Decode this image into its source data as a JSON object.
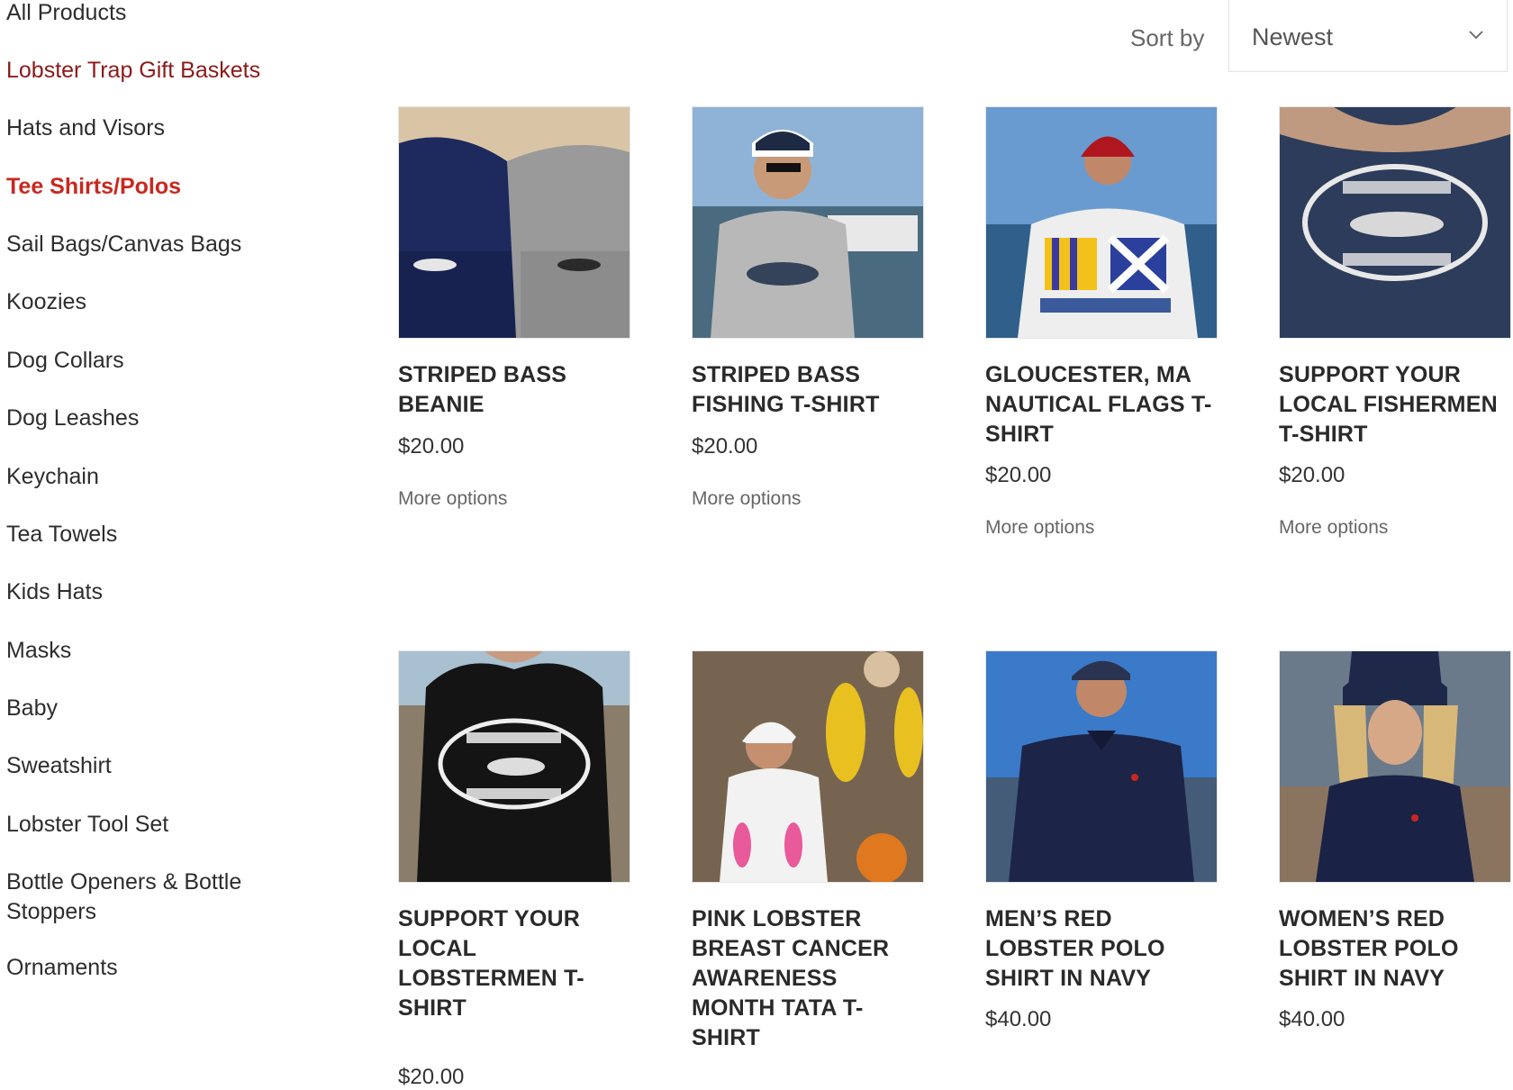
{
  "sidebar": {
    "categories": [
      "All Products",
      "Lobster Trap Gift Baskets",
      "Hats and Visors",
      "Tee Shirts/Polos",
      "Sail Bags/Canvas Bags",
      "Koozies",
      "Dog Collars",
      "Dog Leashes",
      "Keychain",
      "Tea Towels",
      "Kids Hats",
      "Masks",
      "Baby",
      "Sweatshirt",
      "Lobster Tool Set",
      "Bottle Openers & Bottle Stoppers",
      "Ornaments"
    ],
    "active_category": "Tee Shirts/Polos"
  },
  "sort": {
    "label": "Sort by",
    "selected": "Newest",
    "icon": "chevron-down-icon"
  },
  "products": [
    {
      "title": "STRIPED BASS BEANIE",
      "price": "$20.00",
      "action": "More options",
      "image": "navy and grey beanies with striped bass"
    },
    {
      "title": "STRIPED BASS FISHING T-SHIRT",
      "price": "$20.00",
      "action": "More options",
      "image": "man in grey striped bass t-shirt at harbor"
    },
    {
      "title": "GLOUCESTER, MA NAUTICAL FLAGS T-SHIRT",
      "price": "$20.00",
      "action": "More options",
      "image": "man in white Gloucester nautical flags t-shirt"
    },
    {
      "title": "SUPPORT YOUR LOCAL FISHERMEN T-SHIRT",
      "price": "$20.00",
      "action": "More options",
      "image": "navy support your local fishermen t-shirt"
    },
    {
      "title": "SUPPORT YOUR LOCAL LOBSTERMEN T-SHIRT",
      "price": "$20.00",
      "action": "",
      "image": "black support your local lobstermen t-shirt"
    },
    {
      "title": "PINK LOBSTER BREAST CANCER AWARENESS MONTH TATA T-SHIRT",
      "price": "",
      "action": "",
      "image": "woman in white pink lobster t-shirt"
    },
    {
      "title": "MEN’S RED LOBSTER POLO SHIRT IN NAVY",
      "price": "$40.00",
      "action": "",
      "image": "man in navy polo shirt by the ocean"
    },
    {
      "title": "WOMEN’S RED LOBSTER POLO SHIRT IN NAVY",
      "price": "$40.00",
      "action": "",
      "image": "woman in navy polo shirt by the rocks"
    }
  ],
  "colors": {
    "active_category": "#c8281f",
    "featured_category": "#8b1a1a",
    "text": "#2a2a2a"
  }
}
